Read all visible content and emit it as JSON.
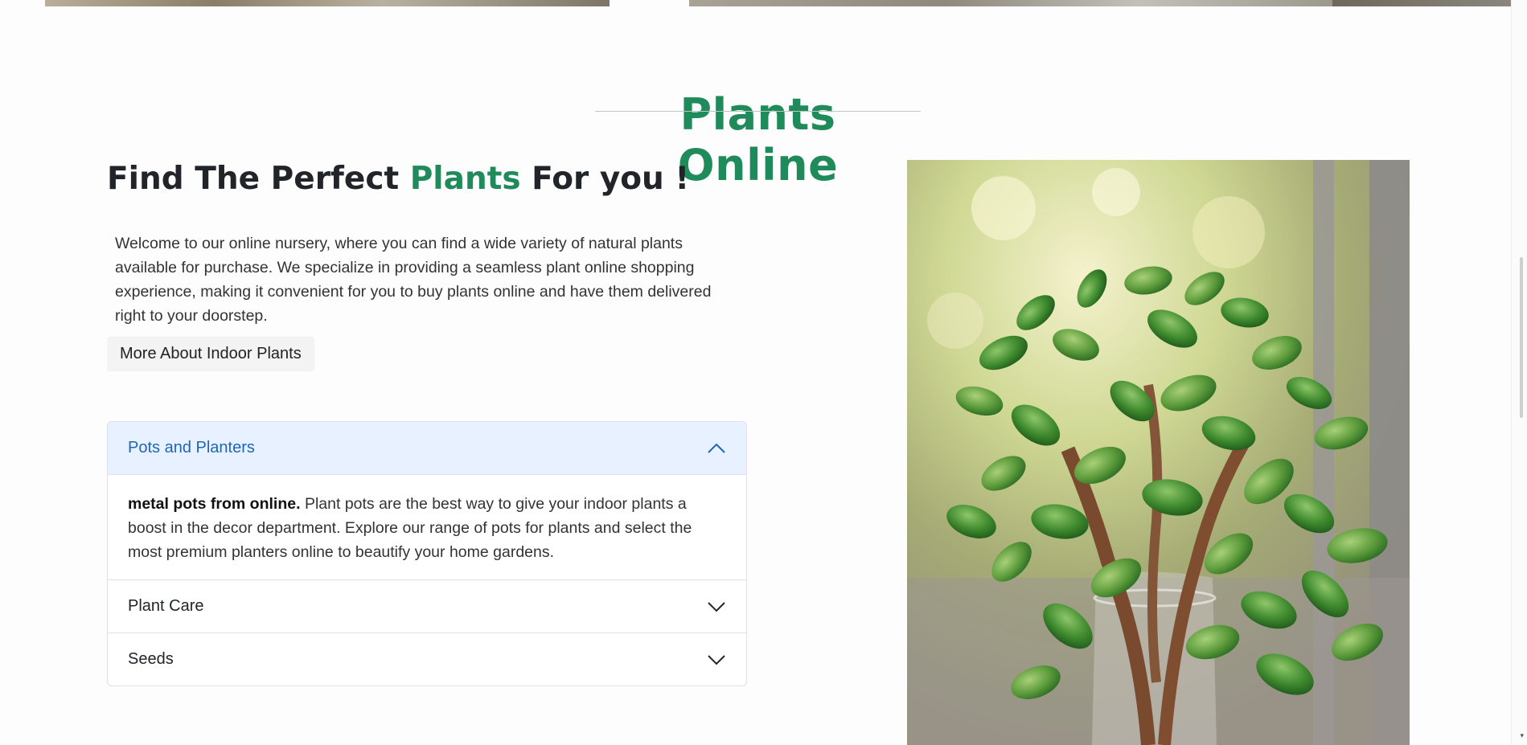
{
  "section": {
    "title": "Plants Online"
  },
  "hero": {
    "headline_before": "Find The Perfect ",
    "headline_accent": "Plants",
    "headline_after": " For you !",
    "intro": "Welcome to our online nursery, where you can find a wide variety of natural plants available for purchase. We specialize in providing a seamless plant online shopping experience, making it convenient for you to buy plants online and have them delivered right to your doorstep.",
    "button_label": "More About Indoor Plants"
  },
  "accordion": {
    "items": [
      {
        "label": "Pots and Planters",
        "open": true,
        "body_bold": "metal pots from online.",
        "body_text": " Plant pots are the best way to give your indoor plants a boost in the decor department. Explore our range of pots for plants and select the most premium planters online to beautify your home gardens."
      },
      {
        "label": "Plant Care",
        "open": false
      },
      {
        "label": "Seeds",
        "open": false
      }
    ]
  },
  "colors": {
    "accent_green": "#1f8a5a",
    "accordion_open_bg": "#e7f1ff",
    "accordion_open_text": "#1f65b8"
  },
  "icons": {
    "open_chevron": "chevron-up-icon",
    "closed_chevron": "chevron-down-icon"
  }
}
